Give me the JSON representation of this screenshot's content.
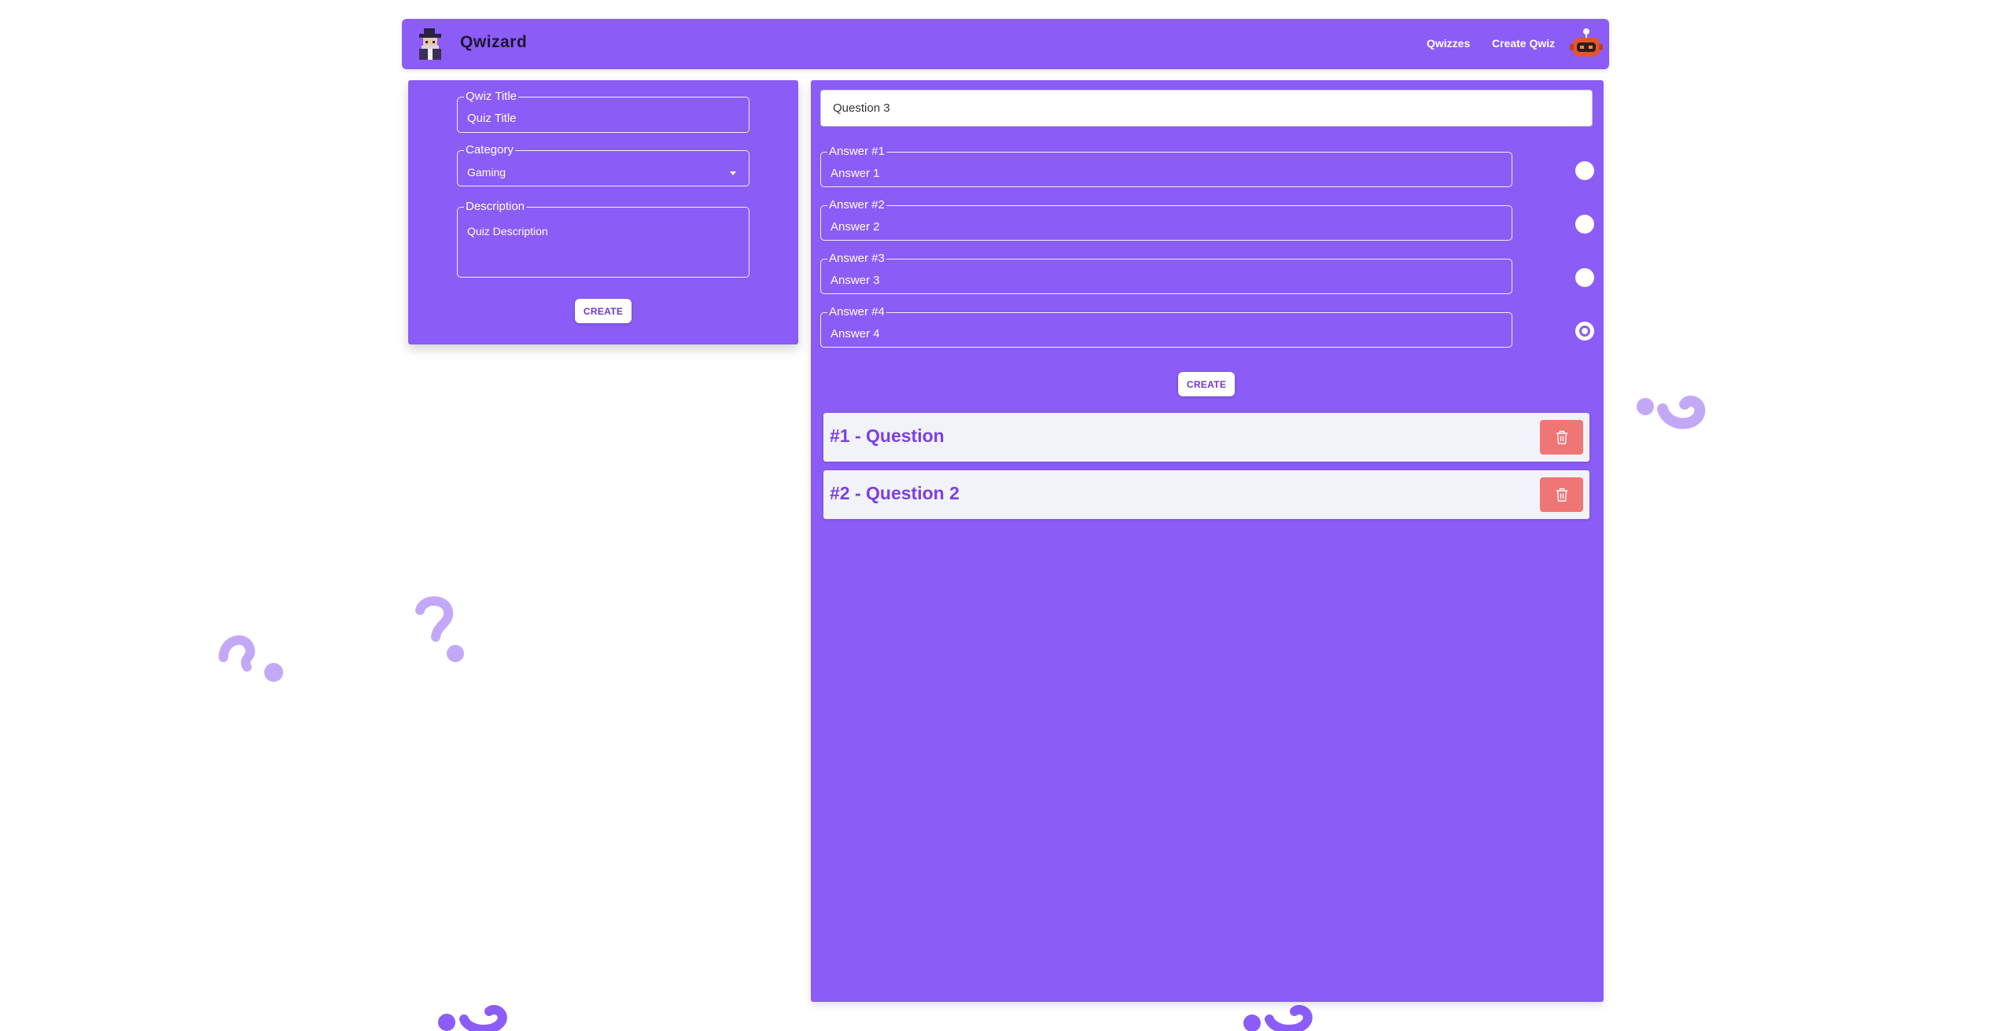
{
  "navbar": {
    "brand": "Qwizard",
    "links": [
      "Qwizzes",
      "Create Qwiz"
    ]
  },
  "quiz_form": {
    "title_legend": "Qwiz Title",
    "title_value": "Quiz Title",
    "category_legend": "Category",
    "category_value": "Gaming",
    "description_legend": "Description",
    "description_value": "Quiz Description",
    "create_label": "CREATE"
  },
  "question_form": {
    "question_value": "Question 3",
    "answers": [
      {
        "legend": "Answer #1",
        "value": "Answer 1"
      },
      {
        "legend": "Answer #2",
        "value": "Answer 2"
      },
      {
        "legend": "Answer #3",
        "value": "Answer 3"
      },
      {
        "legend": "Answer #4",
        "value": "Answer 4"
      }
    ],
    "correct_answer": 4,
    "create_label": "CREATE"
  },
  "questions": [
    {
      "title": "#1 - Question"
    },
    {
      "title": "#2 - Question 2"
    }
  ],
  "colors": {
    "primary": "#8b5cf6",
    "delete": "#f07575",
    "decoration": "#c4a8f8"
  }
}
